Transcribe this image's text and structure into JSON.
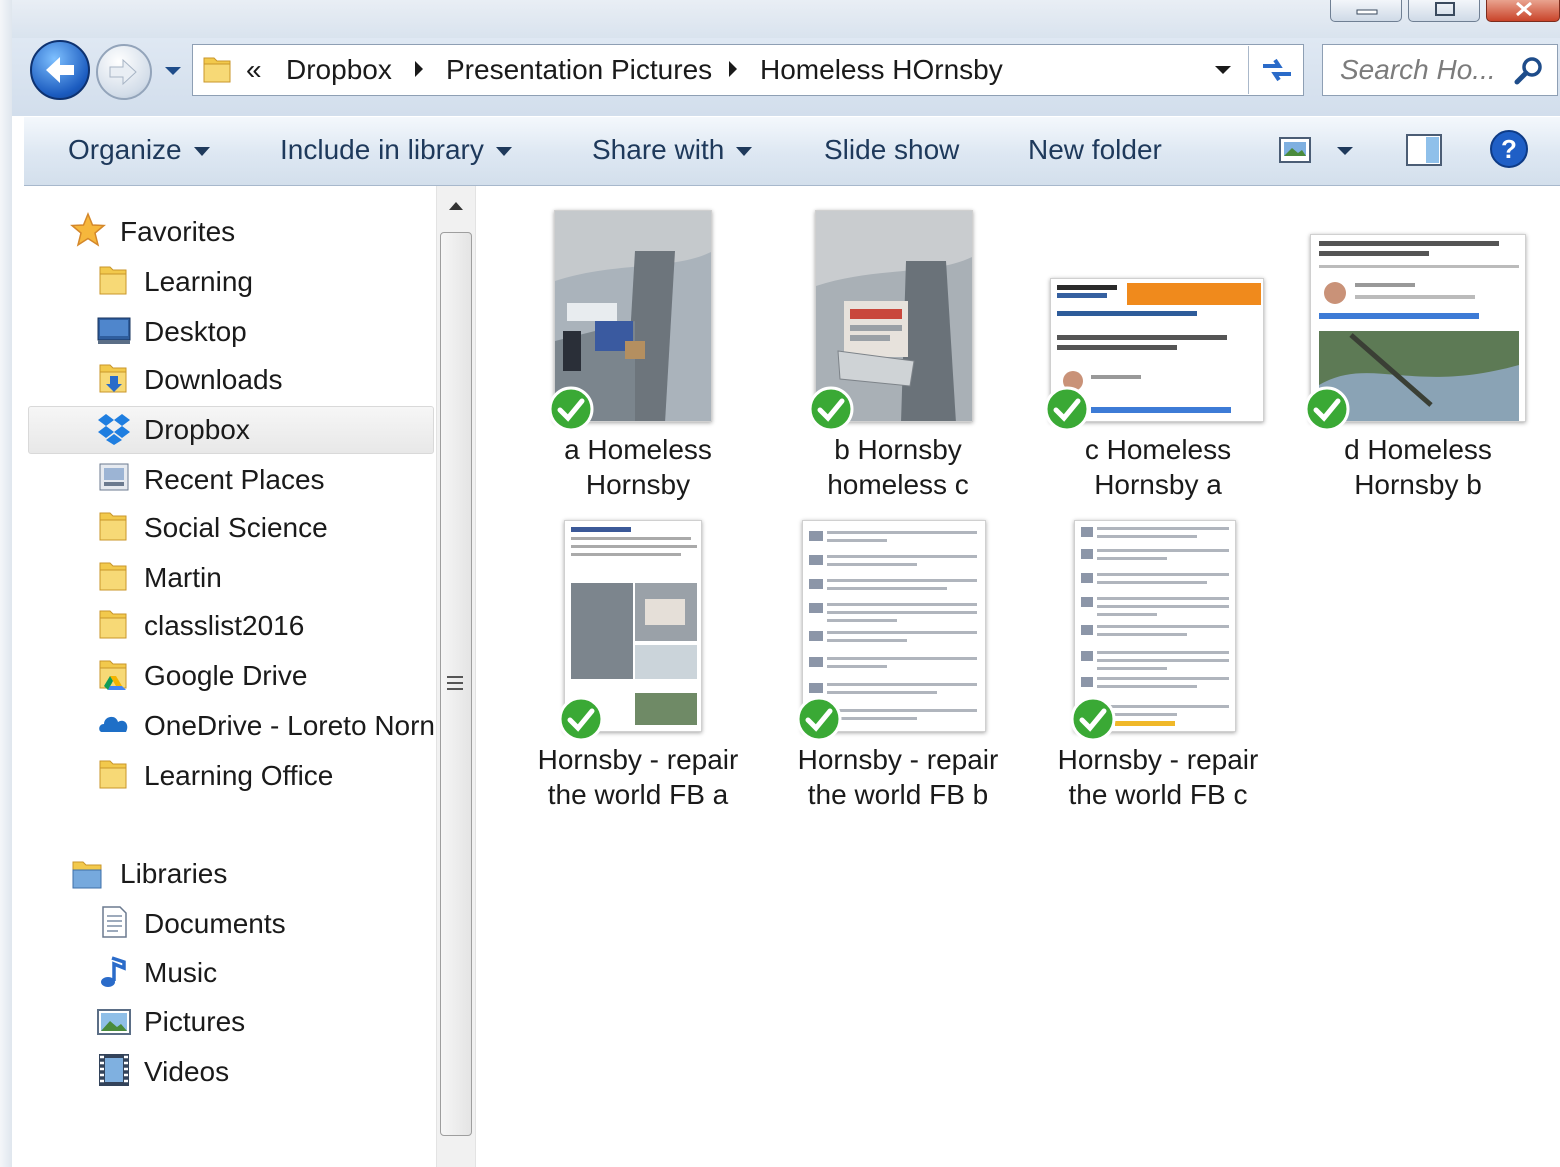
{
  "window": {
    "minimize_icon": "minimize-icon",
    "maximize_icon": "maximize-icon",
    "close_icon": "close-icon"
  },
  "address": {
    "overflow": "«",
    "crumbs": [
      "Dropbox",
      "Presentation Pictures",
      "Homeless HOrnsby"
    ],
    "search_placeholder": "Search Ho..."
  },
  "toolbar": {
    "organize": "Organize",
    "include_in_library": "Include in library",
    "share_with": "Share with",
    "slide_show": "Slide show",
    "new_folder": "New folder"
  },
  "nav": {
    "favorites": {
      "header": "Favorites",
      "items": [
        "Learning",
        "Desktop",
        "Downloads",
        "Dropbox",
        "Recent Places",
        "Social Science",
        "Martin",
        "classlist2016",
        "Google Drive",
        "OneDrive - Loreto Norn",
        "Learning Office"
      ],
      "selected": "Dropbox"
    },
    "libraries": {
      "header": "Libraries",
      "items": [
        "Documents",
        "Music",
        "Pictures",
        "Videos"
      ]
    }
  },
  "files": [
    {
      "name": "a Homeless\nHornsby",
      "kind": "photo",
      "synced": true
    },
    {
      "name": "b Hornsby\nhomeless c",
      "kind": "photo",
      "synced": true
    },
    {
      "name": "c Homeless\nHornsby a",
      "kind": "webpage",
      "synced": true
    },
    {
      "name": "d Homeless\nHornsby b",
      "kind": "webpage",
      "synced": true
    },
    {
      "name": "Hornsby - repair\nthe world FB a",
      "kind": "facebook",
      "synced": true
    },
    {
      "name": "Hornsby - repair\nthe world FB b",
      "kind": "facebook",
      "synced": true
    },
    {
      "name": "Hornsby - repair\nthe world FB c",
      "kind": "facebook",
      "synced": true
    }
  ],
  "colors": {
    "sync_green": "#3aa935",
    "toolbar_text": "#1e395b",
    "window_blue": "#1b5bbf"
  }
}
